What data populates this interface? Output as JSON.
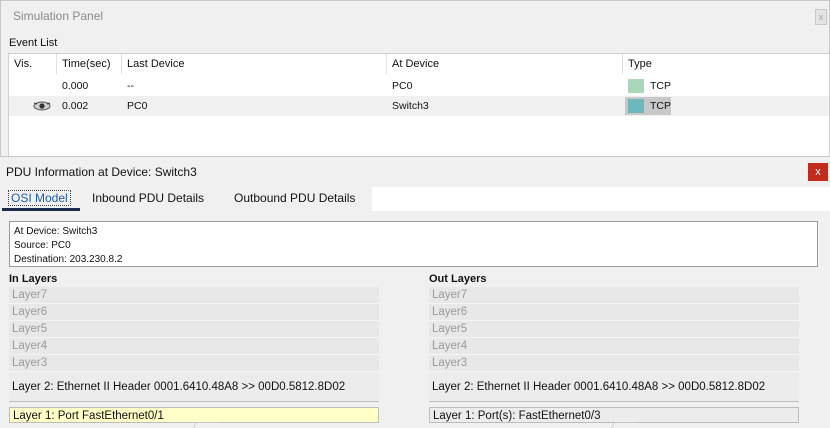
{
  "simulation_panel": {
    "title": "Simulation Panel",
    "close_label": "x",
    "event_list_label": "Event List",
    "columns": [
      "Vis.",
      "Time(sec)",
      "Last Device",
      "At Device",
      "Type"
    ],
    "rows": [
      {
        "visible_icon": "",
        "time": "0.000",
        "last_device": "--",
        "at_device": "PC0",
        "type": "TCP",
        "type_color": "#a8d8b8",
        "selected": false
      },
      {
        "visible_icon": "eye-icon",
        "time": "0.002",
        "last_device": "PC0",
        "at_device": "Switch3",
        "type": "TCP",
        "type_color": "#6bb8bf",
        "selected": true
      }
    ]
  },
  "pdu_info": {
    "title": "PDU Information at Device: Switch3",
    "close_label": "x",
    "tabs": [
      "OSI Model",
      "Inbound PDU Details",
      "Outbound PDU Details"
    ],
    "active_tab": "OSI Model",
    "info": {
      "at_device": "At Device: Switch3",
      "source": "Source: PC0",
      "destination": "Destination: 203.230.8.2"
    },
    "in_layers": {
      "heading": "In Layers",
      "layers": [
        "Layer7",
        "Layer6",
        "Layer5",
        "Layer4",
        "Layer3"
      ],
      "layer2": "Layer 2: Ethernet II Header 0001.6410.48A8 >> 00D0.5812.8D02",
      "layer1": "Layer 1: Port FastEthernet0/1"
    },
    "out_layers": {
      "heading": "Out Layers",
      "layers": [
        "Layer7",
        "Layer6",
        "Layer5",
        "Layer4",
        "Layer3"
      ],
      "layer2": "Layer 2: Ethernet II Header 0001.6410.48A8 >> 00D0.5812.8D02",
      "layer1": "Layer 1: Port(s): FastEthernet0/3"
    }
  },
  "colors": {
    "selected_layer_bg": "#ffffc8",
    "close_button_bg": "#c42b1c",
    "active_tab_underline": "#1d2b4a"
  }
}
